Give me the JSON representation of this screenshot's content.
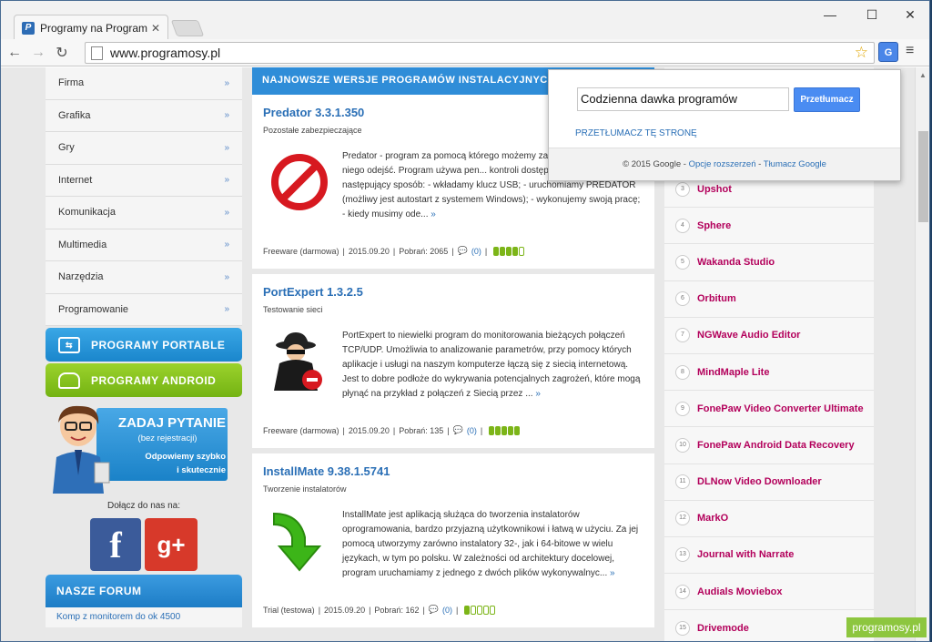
{
  "browser": {
    "tab_title": "Programy na Programosy...",
    "url": "www.programosy.pl",
    "ext_label": "G"
  },
  "left": {
    "categories": [
      "Firma",
      "Grafika",
      "Gry",
      "Internet",
      "Komunikacja",
      "Multimedia",
      "Narzędzia",
      "Programowanie"
    ],
    "portable_label": "PROGRAMY PORTABLE",
    "android_label": "PROGRAMY ANDROID",
    "ask_title": "ZADAJ PYTANIE",
    "ask_sub": "(bez rejestracji)",
    "ask_desc1": "Odpowiemy szybko",
    "ask_desc2": "i skutecznie",
    "join_us": "Dołącz do nas na:",
    "forum_title": "NASZE FORUM",
    "forum_link": "Komp z monitorem do ok 4500"
  },
  "middle": {
    "header": "NAJNOWSZE WERSJE PROGRAMÓW INSTALACYJNYCH",
    "programs": [
      {
        "name": "Predator 3.3.1.350",
        "category": "Pozostałe zabezpieczające",
        "description": "Predator - program za pomocą którego możemy zab... jeżeli musimy od niego odejść. Program używa pen... kontroli dostępu i działa w następujący sposób: - wkładamy klucz USB; - uruchomiamy PREDATOR (możliwy jest autostart z systemem Windows); - wykonujemy swoją pracę; - kiedy musimy ode...",
        "license": "Freeware (darmowa)",
        "date": "2015.09.20",
        "downloads": "Pobrań: 2065",
        "comments": "(0)",
        "rating": 4
      },
      {
        "name": "PortExpert 1.3.2.5",
        "category": "Testowanie sieci",
        "description": "PortExpert to niewielki program do monitorowania bieżących połączeń TCP/UDP. Umożliwia to analizowanie parametrów, przy pomocy których aplikacje i usługi na naszym komputerze łączą się z siecią internetową. Jest to dobre podłoże do wykrywania potencjalnych zagrożeń, które mogą płynąć na przykład z połączeń z Siecią przez ...",
        "license": "Freeware (darmowa)",
        "date": "2015.09.20",
        "downloads": "Pobrań: 135",
        "comments": "(0)",
        "rating": 5
      },
      {
        "name": "InstallMate 9.38.1.5741",
        "category": "Tworzenie instalatorów",
        "description": "InstallMate jest aplikacją służąca do tworzenia instalatorów oprogramowania, bardzo przyjazną użytkownikowi i łatwą w użyciu. Za jej pomocą utworzymy zarówno instalatory 32-, jak i 64-bitowe w wielu językach, w tym po polsku. W zależności od architektury docelowej, program uruchamiamy z jednego z dwóch plików wykonywalnyc...",
        "license": "Trial (testowa)",
        "date": "2015.09.20",
        "downloads": "Pobrań: 162",
        "comments": "(0)",
        "rating": 1
      }
    ]
  },
  "right": {
    "items": [
      {
        "num": "3",
        "label": "Upshot"
      },
      {
        "num": "4",
        "label": "Sphere"
      },
      {
        "num": "5",
        "label": "Wakanda Studio"
      },
      {
        "num": "6",
        "label": "Orbitum"
      },
      {
        "num": "7",
        "label": "NGWave Audio Editor"
      },
      {
        "num": "8",
        "label": "MindMaple Lite"
      },
      {
        "num": "9",
        "label": "FonePaw Video Converter Ultimate"
      },
      {
        "num": "10",
        "label": "FonePaw Android Data Recovery"
      },
      {
        "num": "11",
        "label": "DLNow Video Downloader"
      },
      {
        "num": "12",
        "label": "MarkO"
      },
      {
        "num": "13",
        "label": "Journal with Narrate"
      },
      {
        "num": "14",
        "label": "Audials Moviebox"
      },
      {
        "num": "15",
        "label": "Drivemode"
      }
    ]
  },
  "popup": {
    "input_value": "Codzienna dawka programów",
    "button_label": "Przetłumacz",
    "translate_page": "PRZETŁUMACZ TĘ STRONĘ",
    "footer_copy": "© 2015 Google - ",
    "footer_options": "Opcje rozszerzeń",
    "footer_sep": " - ",
    "footer_translate": "Tłumacz Google"
  },
  "watermark": "programosy.pl",
  "colors": {
    "accent": "#2f8dd8",
    "link": "#2a6fb6",
    "rank_link": "#b3005b",
    "android": "#74b313"
  }
}
